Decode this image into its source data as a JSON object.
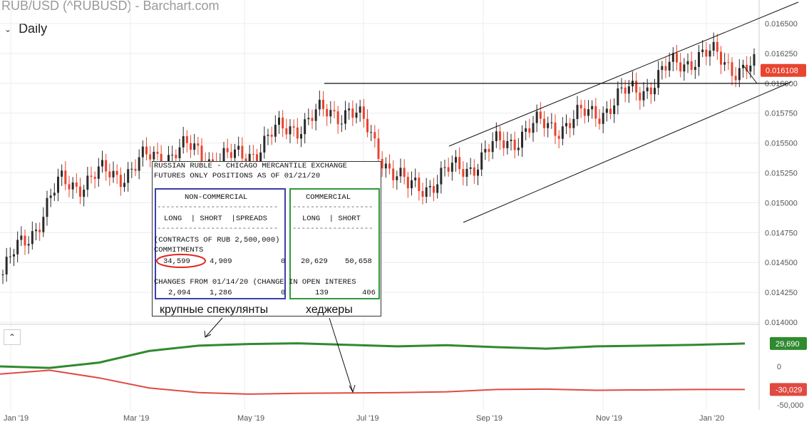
{
  "header": {
    "title": "RUB/USD (^RUBUSD) - Barchart.com",
    "period": "Daily",
    "period_chevron": "chevron-down-icon"
  },
  "chart_data": [
    {
      "type": "candlestick",
      "title": "RUB/USD (^RUBUSD)",
      "y_ticks": [
        "0.016500",
        "0.016250",
        "0.016000",
        "0.015750",
        "0.015500",
        "0.015250",
        "0.015000",
        "0.014750",
        "0.014500",
        "0.014250",
        "0.014000"
      ],
      "ylim": [
        0.014,
        0.0166
      ],
      "last_price": "0.016108",
      "x_ticks": [
        "Jan '19",
        "Mar '19",
        "May '19",
        "Jul '19",
        "Sep '19",
        "Nov '19",
        "Jan '20"
      ],
      "series": [
        {
          "name": "close",
          "x": [
            "Jan '19",
            "Feb '19",
            "Mar '19",
            "Apr '19",
            "May '19",
            "Jun '19",
            "Jul '19",
            "Aug '19",
            "Sep '19",
            "Oct '19",
            "Nov '19",
            "Dec '19",
            "Jan '20",
            "Feb '20"
          ],
          "values": [
            0.0144,
            0.01515,
            0.01525,
            0.01545,
            0.01535,
            0.01565,
            0.0158,
            0.0151,
            0.0153,
            0.0156,
            0.0157,
            0.01595,
            0.01625,
            0.01611
          ]
        }
      ],
      "colors": {
        "up": "#2b2b2b",
        "down": "#e8442f",
        "last_price_bg": "#e8442f"
      }
    },
    {
      "type": "line",
      "y_ticks": [
        "0",
        "-50,000"
      ],
      "series": [
        {
          "name": "",
          "color": "#2f8a2f",
          "last_label": "29,690",
          "values": [
            0,
            -2000,
            5000,
            20000,
            27000,
            29000,
            30000,
            28000,
            26000,
            27500,
            25000,
            23000,
            26000,
            27000,
            28000,
            29690
          ]
        },
        {
          "name": "",
          "color": "#e04a40",
          "last_label": "-30,029",
          "values": [
            -10000,
            -5000,
            -15000,
            -28000,
            -34000,
            -36000,
            -35000,
            -34500,
            -34000,
            -33000,
            -30000,
            -29500,
            -31000,
            -30500,
            -30000,
            -30029
          ]
        }
      ]
    }
  ],
  "cot": {
    "line1": "RUSSIAN RUBLE - CHICAGO MERCANTILE EXCHANGE",
    "line2": "FUTURES ONLY POSITIONS AS OF 01/21/20",
    "nc_header": "NON-COMMERCIAL",
    "c_header": "COMMERCIAL",
    "dashes1": "---------------------------",
    "dashes2": "------------------",
    "cols_nc": "LONG  | SHORT  |SPREADS",
    "cols_c": "LONG  | SHORT",
    "dashes3": "---------------------------",
    "dashes4": "------------------",
    "contracts": "(CONTRACTS OF RUB 2,500,000)",
    "commitments": "COMMITMENTS",
    "nc_long": "34,599",
    "nc_short": "4,909",
    "nc_spreads": "0",
    "c_long": "20,629",
    "c_short": "50,658",
    "changes": "CHANGES FROM 01/14/20 (CHANGE IN OPEN INTERES",
    "ch_nc_long": "2,094",
    "ch_nc_short": "1,286",
    "ch_nc_spreads": "0",
    "ch_c_long": "139",
    "ch_c_short": "406"
  },
  "annotations": {
    "speculators": "крупные спекулянты",
    "hedgers": "хеджеры"
  },
  "lower_toggle": "chevron-up-icon"
}
